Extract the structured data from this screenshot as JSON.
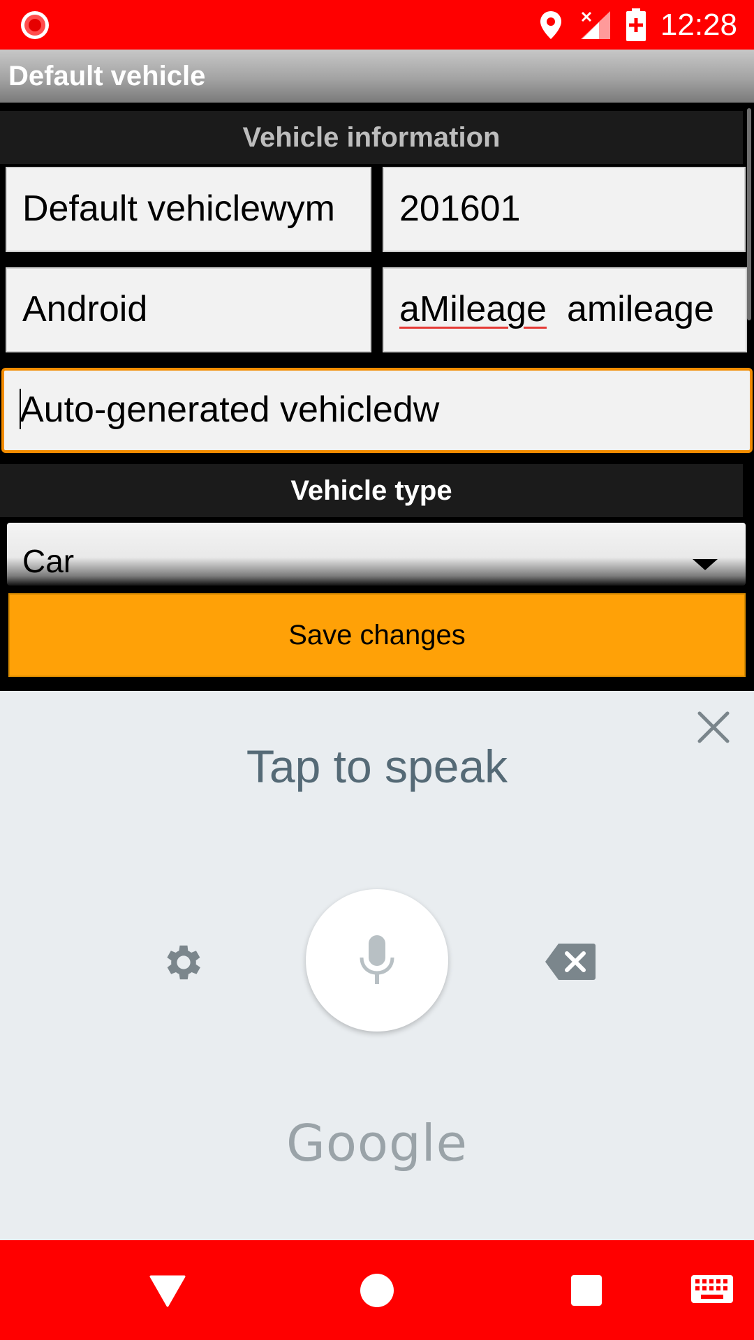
{
  "status_bar": {
    "time": "12:28",
    "icons": [
      "record-icon",
      "location-icon",
      "no-signal-icon",
      "battery-charging-icon"
    ],
    "color": "#ff0000"
  },
  "title_bar": {
    "title": "Default vehicle"
  },
  "form": {
    "vehicle_info_header": "Vehicle information",
    "name_value": "Default vehiclewym ",
    "year_value": "201601",
    "make_value": "Android",
    "model_value_word1": "aMileage",
    "model_value_word2": "amileage",
    "description_value": "Auto-generated vehicledw",
    "vehicle_type_header": "Vehicle type",
    "vehicle_type_selected": "Car",
    "save_label": "Save changes",
    "accent_color": "#ffa107",
    "focus_color": "#f28c00"
  },
  "voice_input": {
    "prompt": "Tap to speak",
    "brand": "Google",
    "icons": [
      "close-icon",
      "settings-icon",
      "microphone-icon",
      "backspace-icon"
    ]
  },
  "nav_bar": {
    "icons": [
      "back-icon",
      "home-icon",
      "recents-icon",
      "keyboard-icon"
    ]
  }
}
